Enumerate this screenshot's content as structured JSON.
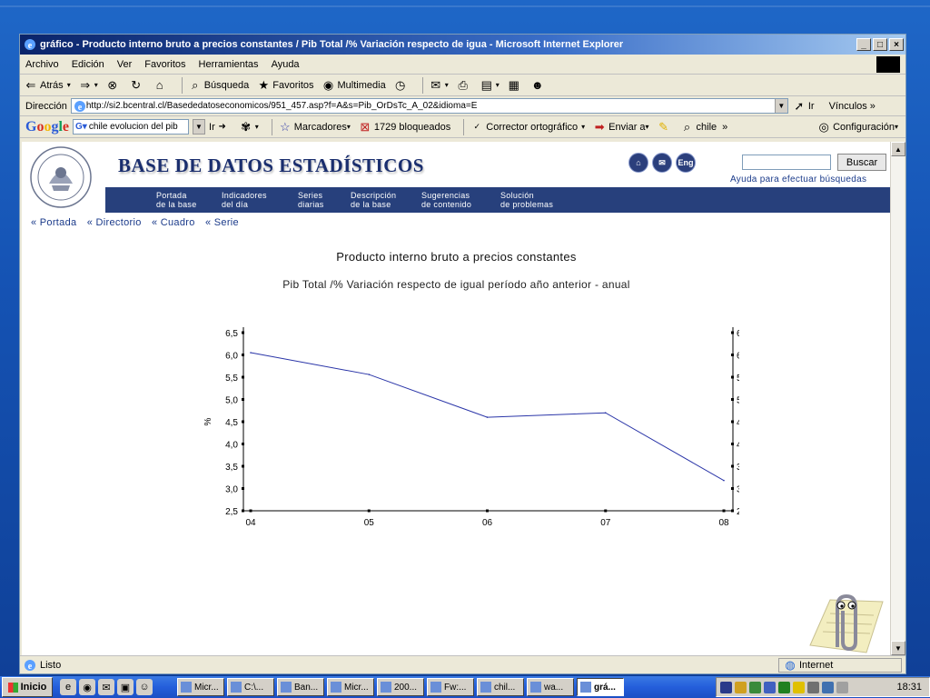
{
  "window": {
    "title": "gráfico - Producto interno bruto a precios constantes / Pib Total /% Variación respecto de igua - Microsoft Internet Explorer",
    "minimize": "_",
    "maximize": "□",
    "close": "×"
  },
  "menu": [
    "Archivo",
    "Edición",
    "Ver",
    "Favoritos",
    "Herramientas",
    "Ayuda"
  ],
  "toolbar": {
    "back": "Atrás",
    "search": "Búsqueda",
    "favorites": "Favoritos",
    "multimedia": "Multimedia"
  },
  "address": {
    "label": "Dirección",
    "url": "http://si2.bcentral.cl/Basededatoseconomicos/951_457.asp?f=A&s=Pib_OrDsTc_A_02&idioma=E",
    "go": "Ir",
    "links": "Vínculos"
  },
  "google": {
    "logo": "Google",
    "query": "chile evolucion del pib",
    "go": "Ir",
    "bookmarks": "Marcadores",
    "blocked": "1729 bloqueados",
    "spell": "Corrector ortográfico",
    "send": "Enviar a",
    "highlight": "chile",
    "settings": "Configuración"
  },
  "site": {
    "title": "BASE DE DATOS ESTADÍSTICOS",
    "icons": [
      "home-icon",
      "mail-icon",
      "english-icon"
    ],
    "eng_label": "Eng",
    "search_button": "Buscar",
    "search_help": "Ayuda para efectuar búsquedas",
    "nav": [
      {
        "l1": "Portada",
        "l2": "de la base"
      },
      {
        "l1": "Indicadores",
        "l2": "del día"
      },
      {
        "l1": "Series",
        "l2": "diarias"
      },
      {
        "l1": "Descripción",
        "l2": "de la base"
      },
      {
        "l1": "Sugerencias",
        "l2": "de contenido"
      },
      {
        "l1": "Solución",
        "l2": "de problemas"
      }
    ],
    "breadcrumbs": [
      "« Portada",
      "« Directorio",
      "« Cuadro",
      "« Serie"
    ]
  },
  "page": {
    "title": "Producto interno bruto a precios constantes",
    "subtitle": "Pib Total /% Variación respecto de igual período año anterior - anual"
  },
  "chart_data": {
    "type": "line",
    "title": "",
    "xlabel": "",
    "ylabel": "%",
    "categories": [
      "04",
      "05",
      "06",
      "07",
      "08"
    ],
    "series": [
      {
        "values": [
          6.05,
          5.56,
          4.6,
          4.7,
          3.18
        ]
      }
    ],
    "ylim": [
      2.5,
      6.5
    ],
    "yticks": [
      "2,5",
      "3,0",
      "3,5",
      "4,0",
      "4,5",
      "5,0",
      "5,5",
      "6,0",
      "6,5"
    ],
    "line_color": "#2a35a8",
    "grid": false,
    "right_axis": true
  },
  "status": {
    "text": "Listo",
    "zone": "Internet"
  },
  "taskbar": {
    "start": "Inicio",
    "tasks": [
      "Micr...",
      "C:\\...",
      "Ban...",
      "Micr...",
      "200...",
      "Fw:...",
      "chil...",
      "wa...",
      "grá..."
    ],
    "active_index": 8,
    "clock": "18:31"
  }
}
